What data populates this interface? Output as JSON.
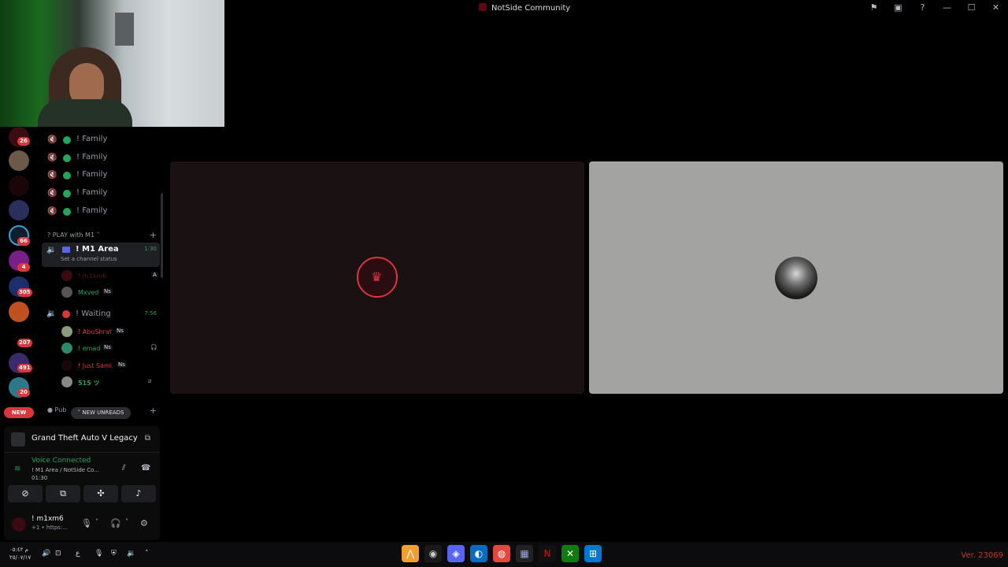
{
  "window": {
    "title": "NotSide Community",
    "controls": [
      "⚑",
      "▣",
      "?",
      "—",
      "☐",
      "✕"
    ]
  },
  "servers": {
    "badges": [
      "26",
      "66",
      "4",
      "305",
      "207",
      "491",
      "20"
    ],
    "new_pill": "NEW"
  },
  "channels": {
    "family_rows": [
      "! Family",
      "! Family",
      "! Family",
      "! Family",
      "! Family"
    ],
    "category": "PLAY with M1",
    "active_channel": {
      "name": "! M1 Area",
      "status": "Set a channel status",
      "timer": "1:30",
      "users": [
        {
          "name": "! m1xm6",
          "tag": "",
          "color": "#da373c"
        },
        {
          "name": "Mxved",
          "tag": "Ns",
          "color": "#23a55a"
        }
      ]
    },
    "waiting_channel": {
      "name": "! Waiting",
      "timer": "7:56",
      "users": [
        {
          "name": "! AbuShrat",
          "tag": "Ns",
          "color": "#da373c"
        },
        {
          "name": "! emad",
          "tag": "Ns",
          "color": "#23a55a"
        },
        {
          "name": "! Just Sami",
          "tag": "Ns",
          "color": "#da373c"
        },
        {
          "name": "515 ツ",
          "tag": "",
          "color": "#23a55a"
        }
      ]
    },
    "public_category": "Pub",
    "new_unreads": "NEW UNREADS"
  },
  "panel": {
    "game": "Grand Theft Auto V Legacy",
    "voice_status": "Voice Connected",
    "voice_channel": "! M1 Area / NotSide Co...",
    "voice_timer": "01:30",
    "user": {
      "name": "! m1xm6",
      "status": "+1 • https:..."
    }
  },
  "taskbar": {
    "clock_line1": "م ٠٥:٤٢",
    "clock_line2": "٢٥/٠٧/١٧",
    "keyboard_lang": "ع",
    "version": "Ver. 23069"
  },
  "colors": {
    "accent_green": "#23a55a",
    "accent_red": "#da373c",
    "blurple": "#5865f2"
  }
}
